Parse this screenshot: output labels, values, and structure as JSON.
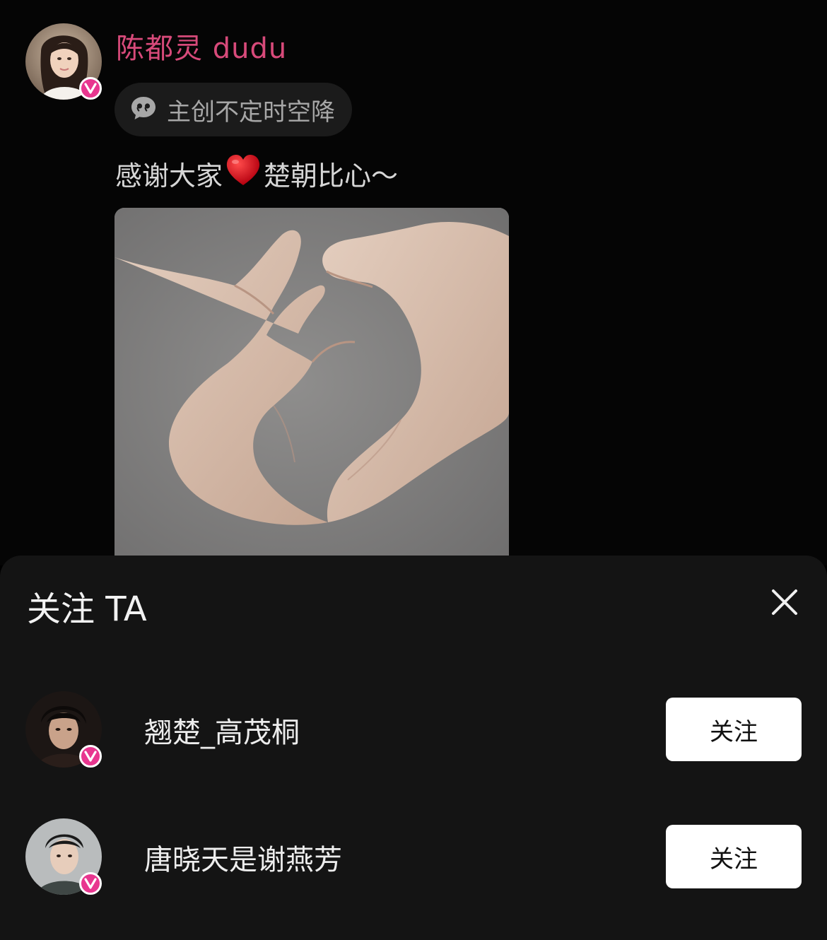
{
  "post": {
    "author_name": "陈都灵 dudu",
    "group_chip": "主创不定时空降",
    "text_before": "感谢大家",
    "text_emoji": "❤️",
    "text_after": "楚朝比心～"
  },
  "sheet": {
    "title": "关注 TA",
    "users": [
      {
        "name": "翘楚_高茂桐",
        "follow_label": "关注"
      },
      {
        "name": "唐晓天是谢燕芳",
        "follow_label": "关注"
      }
    ]
  },
  "colors": {
    "author_name": "#d74a7a",
    "verified_badge": "#e8368f",
    "sheet_background": "#141414",
    "follow_button": "#ffffff"
  },
  "icons": [
    "verified-badge-icon",
    "chat-bubble-icon",
    "close-icon",
    "heart-emoji"
  ]
}
